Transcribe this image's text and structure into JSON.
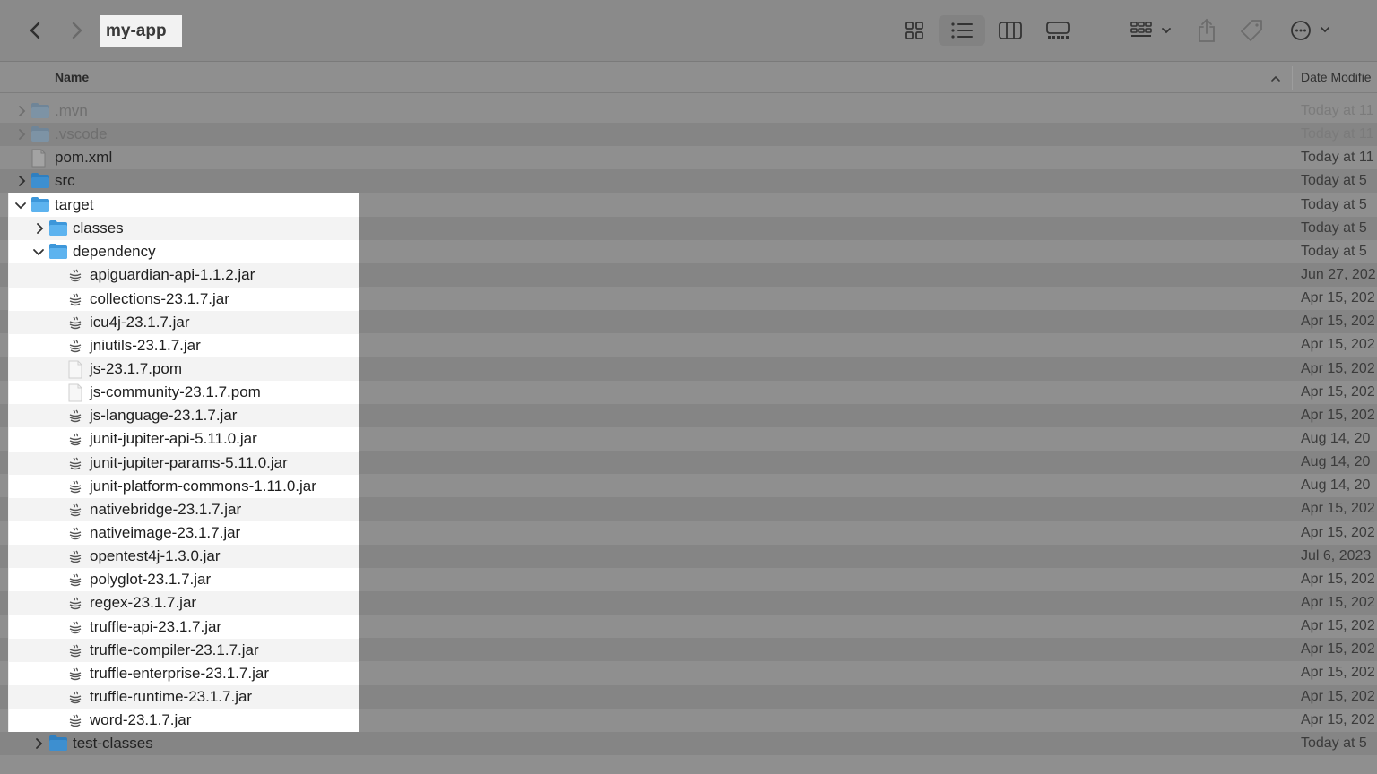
{
  "window": {
    "path_title": "my-app"
  },
  "toolbar": {
    "icons": [
      "back-icon",
      "forward-icon",
      "grid-view-icon",
      "list-view-icon",
      "column-view-icon",
      "gallery-view-icon",
      "group-icon",
      "share-icon",
      "tag-icon",
      "more-icon"
    ],
    "active_view": "list-view-icon"
  },
  "columns": {
    "name": "Name",
    "date": "Date Modifie"
  },
  "top_rows": [
    {
      "name": ".mvn",
      "type": "folder",
      "date": "Today at 11",
      "dim": true,
      "expandable": true
    },
    {
      "name": ".vscode",
      "type": "folder",
      "date": "Today at 11",
      "dim": true,
      "expandable": true
    },
    {
      "name": "pom.xml",
      "type": "file",
      "date": "Today at 11",
      "dim": false,
      "expandable": false
    },
    {
      "name": "src",
      "type": "folder",
      "date": "Today at 5",
      "dim": false,
      "expandable": true
    }
  ],
  "target": {
    "name": "target",
    "date": "Today at 5"
  },
  "classes": {
    "name": "classes",
    "date": "Today at 5"
  },
  "dependency": {
    "name": "dependency",
    "date": "Today at 5"
  },
  "dependency_files": [
    {
      "name": "apiguardian-api-1.1.2.jar",
      "type": "jar",
      "date": "Jun 27, 202"
    },
    {
      "name": "collections-23.1.7.jar",
      "type": "jar",
      "date": "Apr 15, 202"
    },
    {
      "name": "icu4j-23.1.7.jar",
      "type": "jar",
      "date": "Apr 15, 202"
    },
    {
      "name": "jniutils-23.1.7.jar",
      "type": "jar",
      "date": "Apr 15, 202"
    },
    {
      "name": "js-23.1.7.pom",
      "type": "pom",
      "date": "Apr 15, 202"
    },
    {
      "name": "js-community-23.1.7.pom",
      "type": "pom",
      "date": "Apr 15, 202"
    },
    {
      "name": "js-language-23.1.7.jar",
      "type": "jar",
      "date": "Apr 15, 202"
    },
    {
      "name": "junit-jupiter-api-5.11.0.jar",
      "type": "jar",
      "date": "Aug 14, 20"
    },
    {
      "name": "junit-jupiter-params-5.11.0.jar",
      "type": "jar",
      "date": "Aug 14, 20"
    },
    {
      "name": "junit-platform-commons-1.11.0.jar",
      "type": "jar",
      "date": "Aug 14, 20"
    },
    {
      "name": "nativebridge-23.1.7.jar",
      "type": "jar",
      "date": "Apr 15, 202"
    },
    {
      "name": "nativeimage-23.1.7.jar",
      "type": "jar",
      "date": "Apr 15, 202"
    },
    {
      "name": "opentest4j-1.3.0.jar",
      "type": "jar",
      "date": "Jul 6, 2023"
    },
    {
      "name": "polyglot-23.1.7.jar",
      "type": "jar",
      "date": "Apr 15, 202"
    },
    {
      "name": "regex-23.1.7.jar",
      "type": "jar",
      "date": "Apr 15, 202"
    },
    {
      "name": "truffle-api-23.1.7.jar",
      "type": "jar",
      "date": "Apr 15, 202"
    },
    {
      "name": "truffle-compiler-23.1.7.jar",
      "type": "jar",
      "date": "Apr 15, 202"
    },
    {
      "name": "truffle-enterprise-23.1.7.jar",
      "type": "jar",
      "date": "Apr 15, 202"
    },
    {
      "name": "truffle-runtime-23.1.7.jar",
      "type": "jar",
      "date": "Apr 15, 202"
    },
    {
      "name": "word-23.1.7.jar",
      "type": "jar",
      "date": "Apr 15, 202"
    }
  ],
  "test_classes": {
    "name": "test-classes",
    "date": "Today at 5"
  },
  "colors": {
    "folder": "#4aa6e6",
    "folder_dark": "#2f7fc0",
    "background_dim": "#8f8f8f",
    "highlight": "#ffffff"
  }
}
